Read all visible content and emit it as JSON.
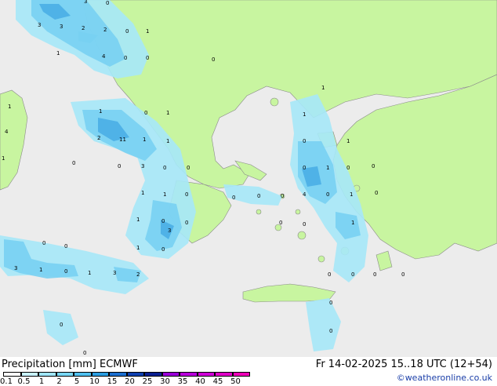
{
  "footer": {
    "title": "Precipitation [mm]  ECMWF",
    "datetime": "Fr 14-02-2025 15..18 UTC (12+54)",
    "credit": "©weatheronline.co.uk"
  },
  "legend": {
    "labels": [
      "0.1",
      "0.5",
      "1",
      "2",
      "5",
      "10",
      "15",
      "20",
      "25",
      "30",
      "35",
      "40",
      "45",
      "50"
    ],
    "colors": [
      "#ffffff",
      "#c8f2ff",
      "#a0e6fa",
      "#78d7f5",
      "#50c0ef",
      "#2a9de0",
      "#1c6fd0",
      "#1040b0",
      "#0a1f90",
      "#9a00d8",
      "#b800dc",
      "#d000d8",
      "#e000c8",
      "#f000b8"
    ]
  },
  "map": {
    "sea_color": "#ececec",
    "land_color": "#c8f5a0",
    "precip_colors": [
      "#a6e8f8",
      "#78d0f2",
      "#4aaee6"
    ],
    "values": [
      "3",
      "0",
      "3",
      "2",
      "2",
      "0",
      "1",
      "3",
      "4",
      "0",
      "0",
      "1",
      "0",
      "1",
      "1",
      "0",
      "1",
      "2",
      "11",
      "1",
      "1",
      "3",
      "0",
      "0",
      "0",
      "1",
      "1",
      "0",
      "0",
      "1",
      "4",
      "1",
      "0",
      "0",
      "3",
      "3",
      "1",
      "0",
      "2",
      "1",
      "3",
      "1",
      "0",
      "1",
      "0",
      "1",
      "0",
      "1",
      "4",
      "0",
      "1",
      "0",
      "0",
      "1",
      "0",
      "0",
      "0",
      "1",
      "0",
      "0",
      "0",
      "0",
      "0",
      "0",
      "0",
      "0",
      "0",
      "0",
      "0",
      "0",
      "0"
    ]
  }
}
